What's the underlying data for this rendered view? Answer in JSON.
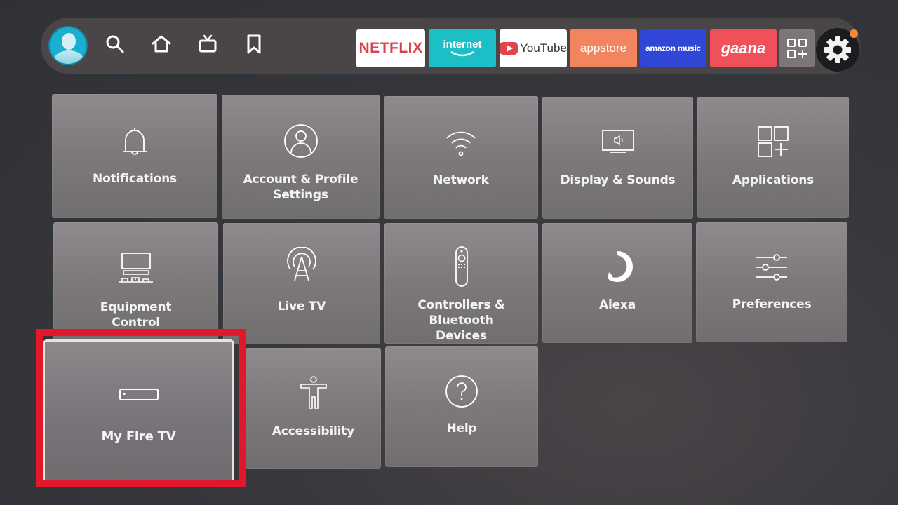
{
  "topbar": {
    "nav": [
      {
        "name": "profile",
        "icon": "avatar-icon"
      },
      {
        "name": "search",
        "icon": "search-icon"
      },
      {
        "name": "home",
        "icon": "home-icon"
      },
      {
        "name": "live",
        "icon": "tv-icon"
      },
      {
        "name": "watchlist",
        "icon": "bookmark-icon"
      }
    ],
    "apps": [
      {
        "label": "NETFLIX",
        "bg": "#ffffff",
        "color": "#d9434b"
      },
      {
        "label": "internet",
        "bg": "#1dbfc7",
        "color": "#ffffff"
      },
      {
        "label": "YouTube",
        "bg": "#ffffff",
        "color": "#333333"
      },
      {
        "label": "appstore",
        "bg": "#f2855f",
        "color": "#ffffff"
      },
      {
        "label": "amazon music",
        "bg": "#3046d6",
        "color": "#ffffff"
      },
      {
        "label": "gaana",
        "bg": "#f0505a",
        "color": "#ffffff"
      }
    ],
    "all_apps_icon": "grid-plus-icon",
    "settings_icon": "gear-icon",
    "notification_dot_color": "#f28a3a"
  },
  "settings": {
    "tiles": [
      {
        "label": "Notifications",
        "icon": "bell-icon"
      },
      {
        "label": "Account & Profile Settings",
        "icon": "user-circle-icon"
      },
      {
        "label": "Network",
        "icon": "wifi-icon"
      },
      {
        "label": "Display & Sounds",
        "icon": "display-sound-icon"
      },
      {
        "label": "Applications",
        "icon": "apps-icon"
      },
      {
        "label": "Equipment Control",
        "icon": "equipment-icon"
      },
      {
        "label": "Live TV",
        "icon": "antenna-icon"
      },
      {
        "label": "Controllers & Bluetooth Devices",
        "icon": "remote-icon"
      },
      {
        "label": "Alexa",
        "icon": "alexa-icon"
      },
      {
        "label": "Preferences",
        "icon": "sliders-icon"
      },
      {
        "label": "My Fire TV",
        "icon": "fire-tv-device-icon",
        "focused": true
      },
      {
        "label": "Accessibility",
        "icon": "accessibility-icon"
      },
      {
        "label": "Help",
        "icon": "help-icon"
      }
    ],
    "label_lines": {
      "account": [
        "Account & Profile",
        "Settings"
      ],
      "equipment": [
        "Equipment",
        "Control"
      ],
      "controllers": [
        "Controllers & Bluetooth",
        "Devices"
      ]
    }
  },
  "annotation": {
    "highlight_color": "#e3172c",
    "target": "My Fire TV"
  }
}
